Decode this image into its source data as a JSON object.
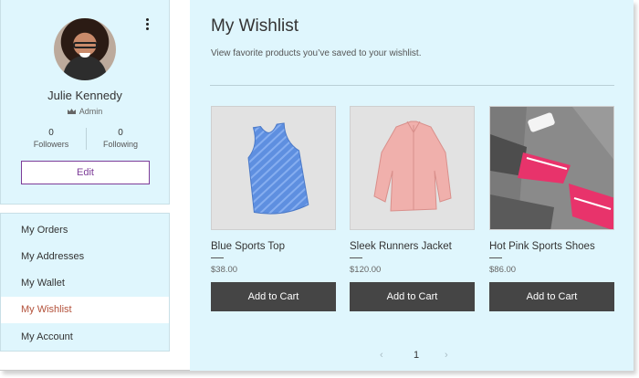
{
  "profile": {
    "name": "Julie Kennedy",
    "role": "Admin",
    "followers_count": "0",
    "followers_label": "Followers",
    "following_count": "0",
    "following_label": "Following",
    "edit_label": "Edit",
    "accent_color": "#7d3c98"
  },
  "nav": {
    "items": [
      {
        "label": "My Orders"
      },
      {
        "label": "My Addresses"
      },
      {
        "label": "My Wallet"
      },
      {
        "label": "My Wishlist"
      },
      {
        "label": "My Account"
      }
    ],
    "active": "My Wishlist",
    "active_color": "#b3513a"
  },
  "main": {
    "title": "My Wishlist",
    "subtitle": "View favorite products you’ve saved to your wishlist.",
    "background": "#dff6fd"
  },
  "products": [
    {
      "name": "Blue Sports Top",
      "price": "$38.00",
      "button": "Add to Cart",
      "image": "blue-tank-top"
    },
    {
      "name": "Sleek Runners Jacket",
      "price": "$120.00",
      "button": "Add to Cart",
      "image": "pink-jacket"
    },
    {
      "name": "Hot Pink Sports Shoes",
      "price": "$86.00",
      "button": "Add to Cart",
      "image": "pink-sneakers"
    }
  ],
  "pagination": {
    "prev": "‹",
    "current": "1",
    "next": "›"
  }
}
